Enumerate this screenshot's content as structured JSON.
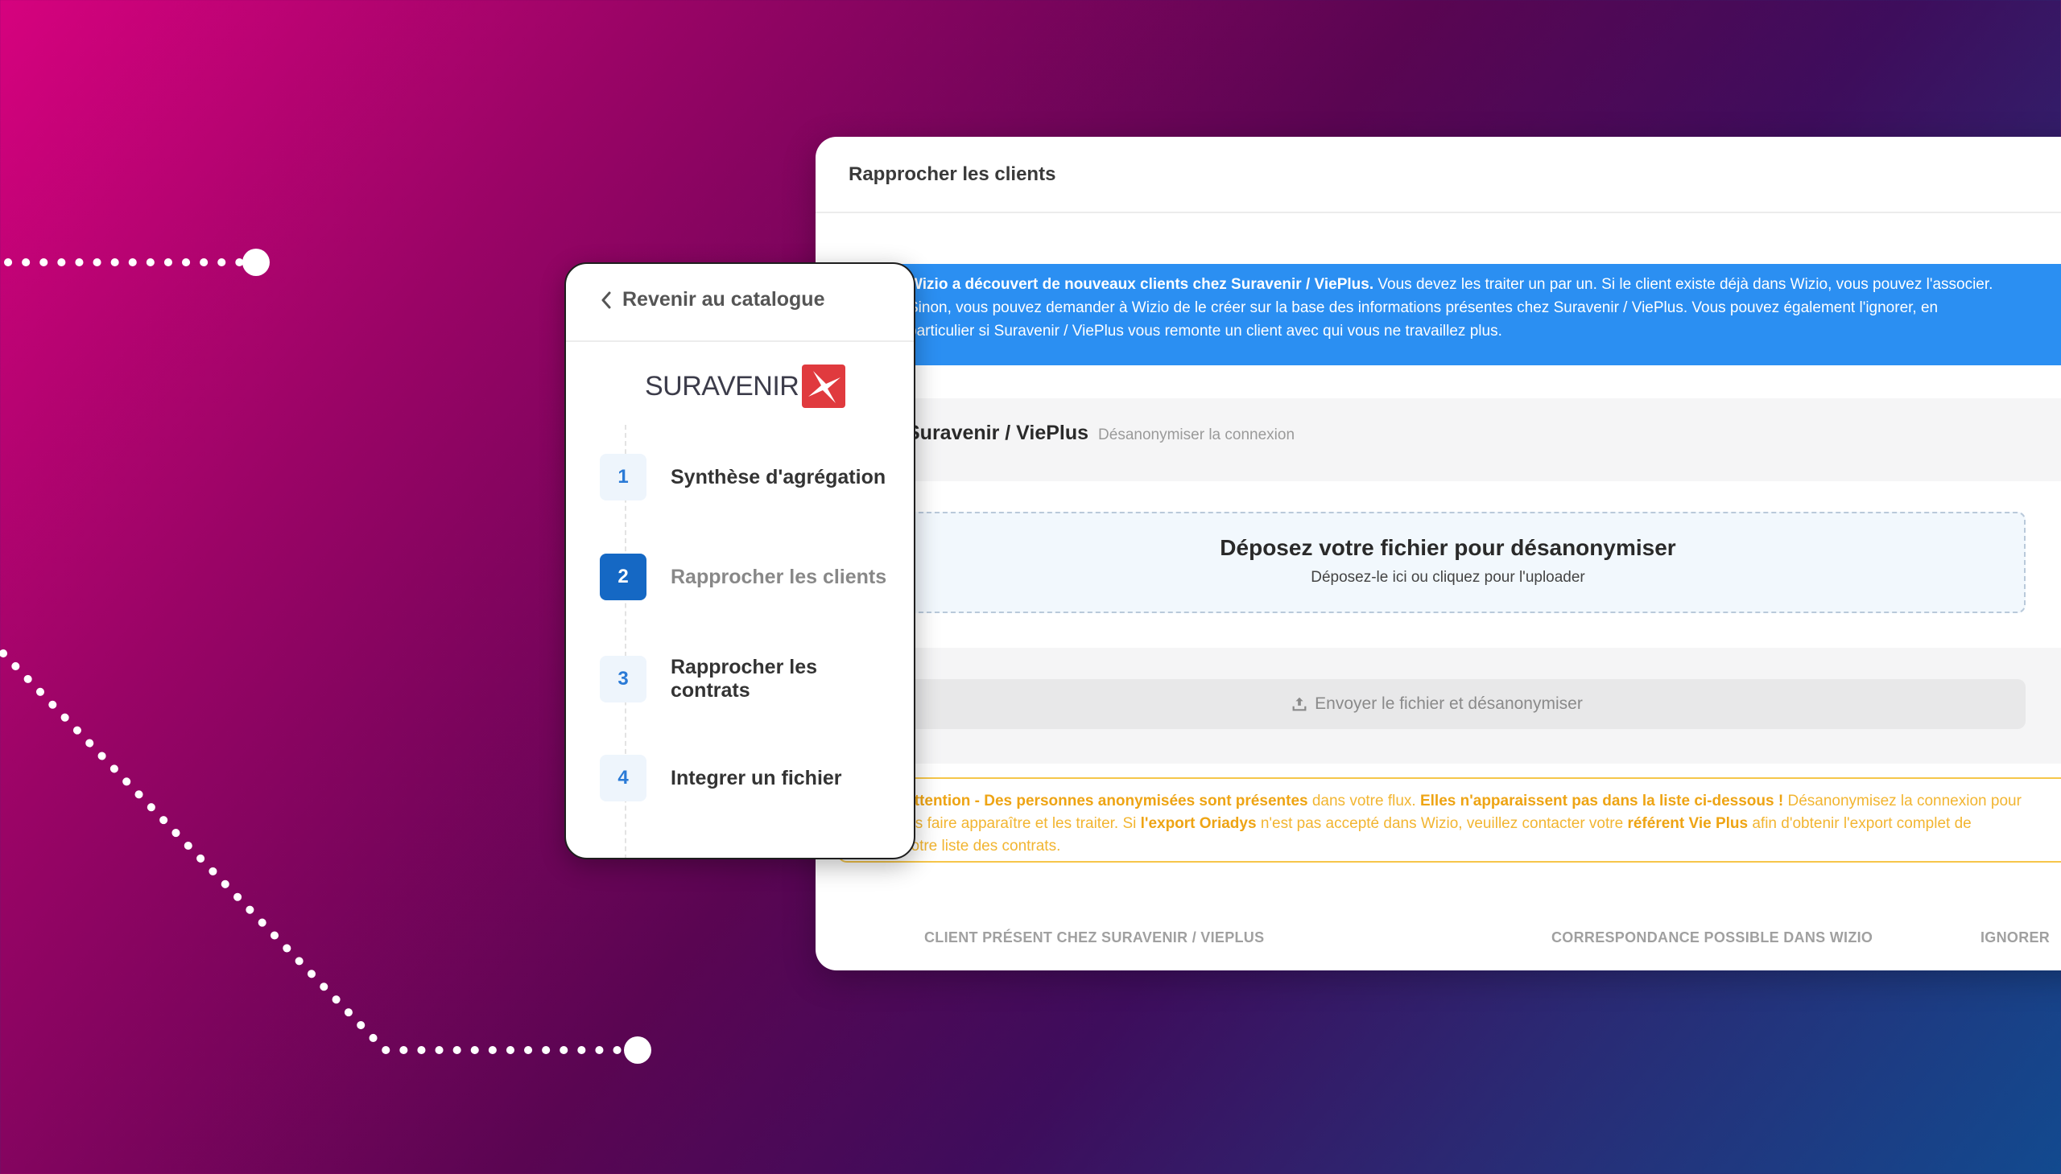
{
  "main": {
    "title": "Rapprocher les clients",
    "info_bold": "Wizio a découvert de nouveaux clients chez Suravenir / ViePlus.",
    "info_line1_rest": " Vous devez les traiter un par un. Si le client existe déjà dans Wizio, vous pouvez l'associer.",
    "info_line2": "Sinon, vous pouvez demander à Wizio de le créer sur la base des informations présentes chez Suravenir / ViePlus. Vous pouvez également l'ignorer, en",
    "info_line3": "particulier si Suravenir / ViePlus vous remonte un client avec qui vous ne travaillez plus.",
    "connection_title": "Suravenir / ViePlus",
    "connection_action": "Désanonymiser la connexion",
    "dropzone_title": "Déposez votre fichier pour désanonymiser",
    "dropzone_sub": "Déposez-le ici ou cliquez pour l'uploader",
    "send_button": "Envoyer le fichier et désanonymiser",
    "warn": {
      "l1_a": "Attention - Des personnes anonymisées sont présentes",
      "l1_b": " dans votre flux. ",
      "l1_c": "Elles n'apparaissent pas dans la liste ci-dessous !",
      "l1_d": " Désanonymisez la connexion pour",
      "l2_a": "les faire apparaître et les traiter. Si ",
      "l2_b": "l'export Oriadys",
      "l2_c": " n'est pas accepté dans Wizio, veuillez contacter votre ",
      "l2_d": "référent Vie Plus",
      "l2_e": " afin d'obtenir l'export complet de",
      "l3": "votre liste des contrats."
    },
    "columns": [
      "CLIENT PRÉSENT CHEZ SURAVENIR / VIEPLUS",
      "CORRESPONDANCE POSSIBLE DANS WIZIO",
      "IGNORER"
    ]
  },
  "side": {
    "back_label": "Revenir au catalogue",
    "logo_text": "SURAVENIR",
    "steps": [
      {
        "num": "1",
        "label": "Synthèse d'agrégation"
      },
      {
        "num": "2",
        "label": "Rapprocher les clients"
      },
      {
        "num": "3",
        "label": "Rapprocher les contrats"
      },
      {
        "num": "4",
        "label": "Integrer un fichier"
      }
    ],
    "active_step": 2
  },
  "colors": {
    "info_banner": "#2b8ff2",
    "active_step": "#1568c4",
    "warning": "#f6c64a",
    "logo_red": "#e03a3e"
  }
}
